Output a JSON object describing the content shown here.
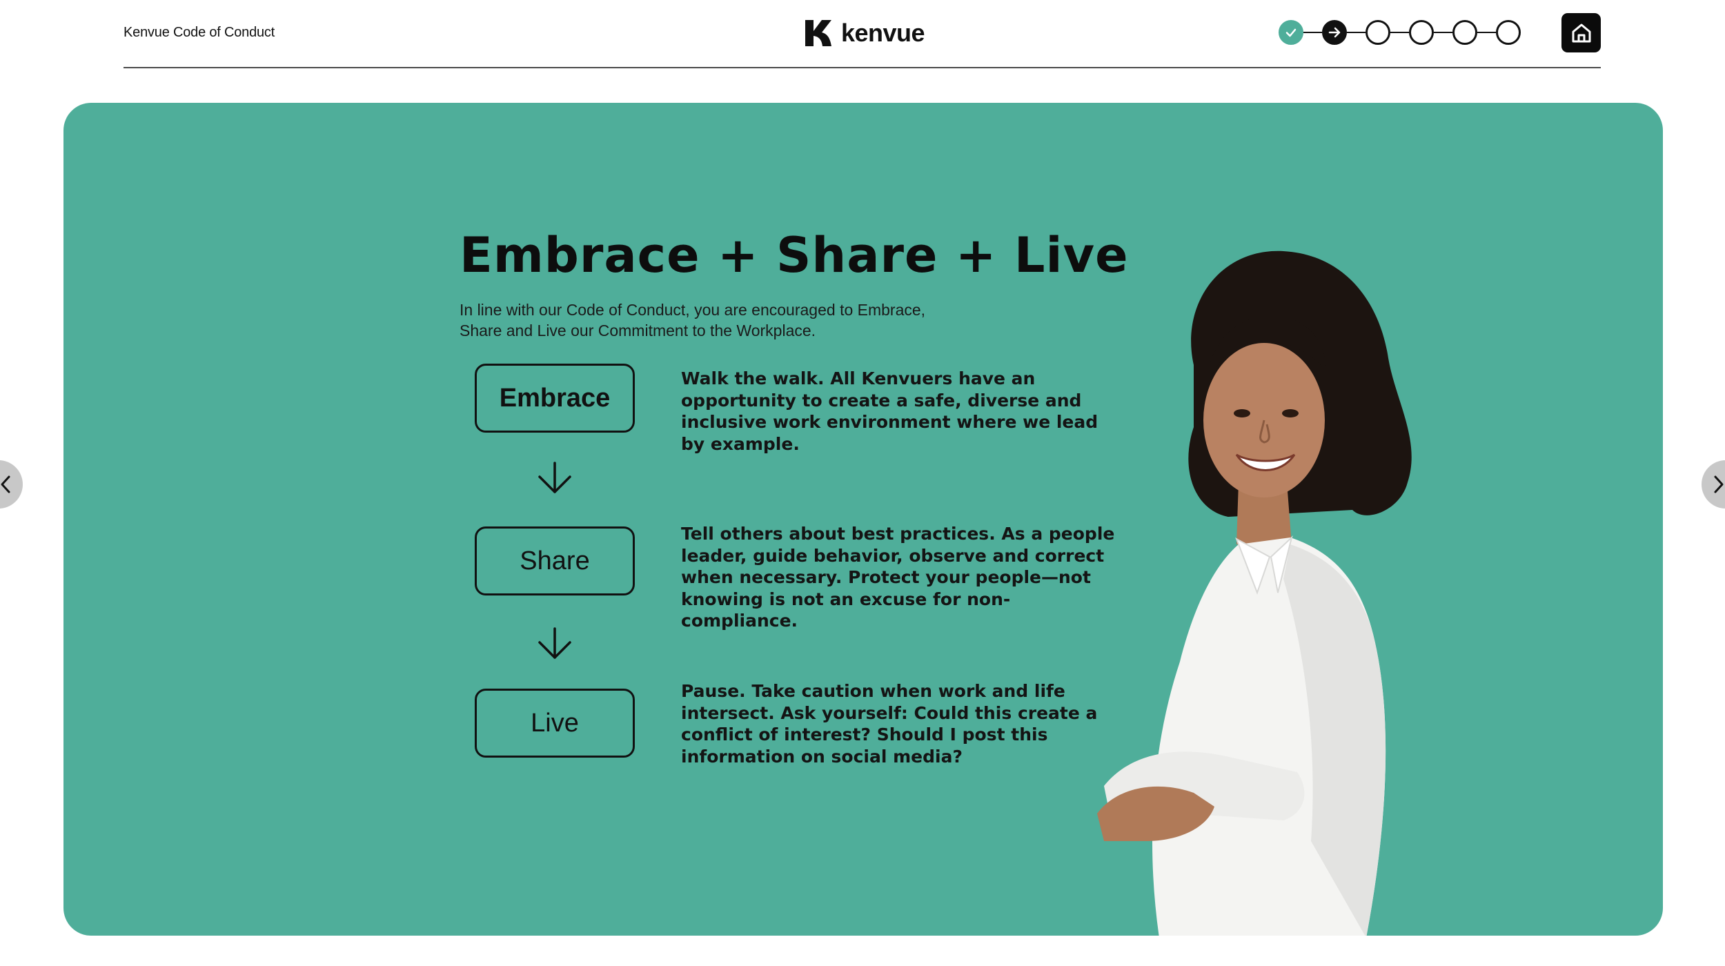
{
  "header": {
    "course_title": "Kenvue Code of Conduct",
    "logo_text": "kenvue",
    "progress": {
      "steps": [
        "completed",
        "current",
        "upcoming",
        "upcoming",
        "upcoming",
        "upcoming"
      ],
      "accent_color": "#4fae9a"
    },
    "home_icon": "home-icon"
  },
  "card": {
    "background_color": "#4fae9a",
    "headline": "Embrace + Share + Live",
    "intro": "In line with our Code of Conduct, you are encouraged to Embrace, Share and Live our Commitment to the Workplace.",
    "steps": [
      {
        "label": "Embrace",
        "description": "Walk the walk. All Kenvuers have an opportunity to create a safe, diverse and inclusive work environment where we lead by example."
      },
      {
        "label": "Share",
        "description": "Tell others about best practices. As a people leader, guide behavior, observe and correct when necessary. Protect your people—not knowing is not an excuse for non-compliance."
      },
      {
        "label": "Live",
        "description": "Pause. Take caution when work and life intersect. Ask yourself: Could this create a conflict of interest? Should I post this information on social media?"
      }
    ]
  },
  "navigation": {
    "prev_icon": "chevron-left-icon",
    "next_icon": "chevron-right-icon"
  }
}
